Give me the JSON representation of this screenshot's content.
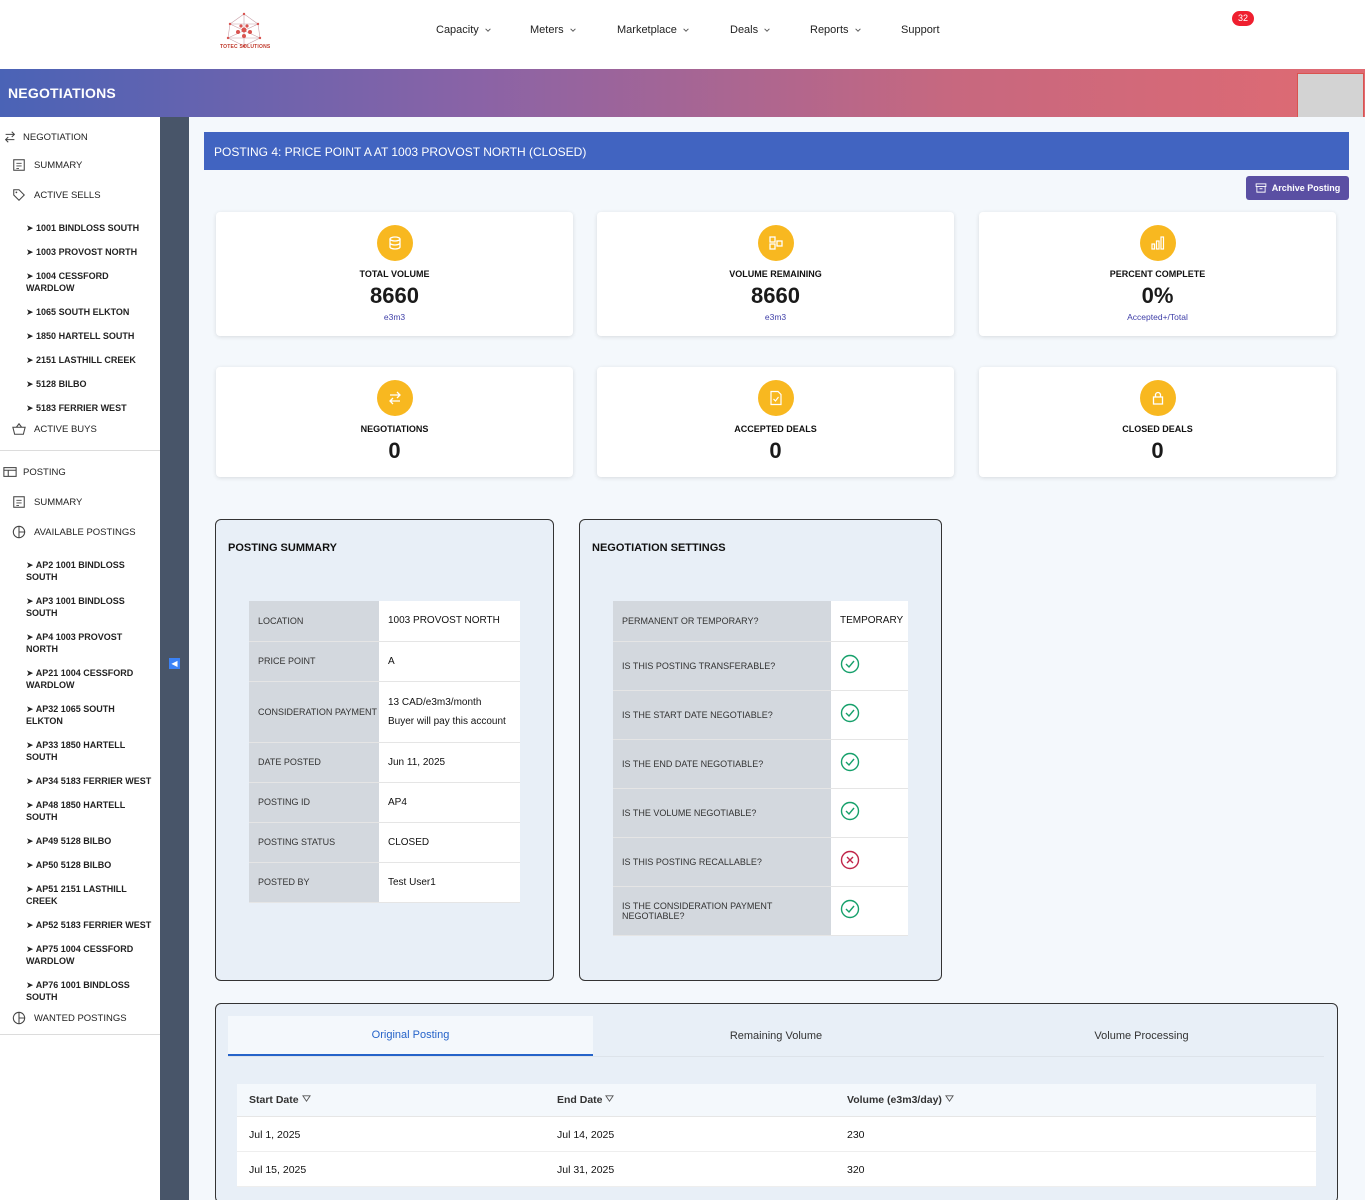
{
  "brand": {
    "logo_text": "TOTEC SOLUTIONS"
  },
  "nav": [
    {
      "label": "Capacity",
      "has_menu": true
    },
    {
      "label": "Meters",
      "has_menu": true
    },
    {
      "label": "Marketplace",
      "has_menu": true
    },
    {
      "label": "Deals",
      "has_menu": true
    },
    {
      "label": "Reports",
      "has_menu": true
    },
    {
      "label": "Support",
      "has_menu": false
    }
  ],
  "header": {
    "title": "NEGOTIATIONS",
    "notifications_count": "32"
  },
  "sidebar": {
    "negotiation_label": "NEGOTIATION",
    "negotiation_summary": "SUMMARY",
    "active_sells_label": "ACTIVE SELLS",
    "active_sells": [
      "➤ 1001 BINDLOSS SOUTH",
      "➤ 1003 PROVOST NORTH",
      "➤ 1004 CESSFORD WARDLOW",
      "➤ 1065 SOUTH ELKTON",
      "➤ 1850 HARTELL SOUTH",
      "➤ 2151 LASTHILL CREEK",
      "➤ 5128 BILBO",
      "➤ 5183 FERRIER WEST"
    ],
    "active_buys_label": "ACTIVE BUYS",
    "posting_label": "POSTING",
    "posting_summary": "SUMMARY",
    "available_postings_label": "AVAILABLE POSTINGS",
    "available_postings": [
      "➤ AP2 1001 BINDLOSS SOUTH",
      "➤ AP3 1001 BINDLOSS SOUTH",
      "➤ AP4 1003 PROVOST NORTH",
      "➤ AP21 1004 CESSFORD WARDLOW",
      "➤ AP32 1065 SOUTH ELKTON",
      "➤ AP33 1850 HARTELL SOUTH",
      "➤ AP34 5183 FERRIER WEST",
      "➤ AP48 1850 HARTELL SOUTH",
      "➤ AP49 5128 BILBO",
      "➤ AP50 5128 BILBO",
      "➤ AP51 2151 LASTHILL CREEK",
      "➤ AP52 5183 FERRIER WEST",
      "➤ AP75 1004 CESSFORD WARDLOW",
      "➤ AP76 1001 BINDLOSS SOUTH"
    ],
    "wanted_postings_label": "WANTED POSTINGS"
  },
  "posting": {
    "title": "POSTING 4: PRICE POINT A AT 1003 PROVOST NORTH (CLOSED)",
    "archive_label": "Archive Posting"
  },
  "stats": [
    {
      "label": "TOTAL VOLUME",
      "value": "8660",
      "sub": "e3m3",
      "icon": "database-icon"
    },
    {
      "label": "VOLUME REMAINING",
      "value": "8660",
      "sub": "e3m3",
      "icon": "shapes-icon"
    },
    {
      "label": "PERCENT COMPLETE",
      "value": "0%",
      "sub": "Accepted+/Total",
      "icon": "bar-chart-icon"
    },
    {
      "label": "NEGOTIATIONS",
      "value": "0",
      "sub": "",
      "icon": "swap-icon"
    },
    {
      "label": "ACCEPTED DEALS",
      "value": "0",
      "sub": "",
      "icon": "document-check-icon"
    },
    {
      "label": "CLOSED DEALS",
      "value": "0",
      "sub": "",
      "icon": "lock-icon"
    }
  ],
  "posting_summary": {
    "title": "POSTING SUMMARY",
    "rows": [
      {
        "key": "LOCATION",
        "value": "1003 PROVOST NORTH"
      },
      {
        "key": "PRICE POINT",
        "value": "A"
      },
      {
        "key": "CONSIDERATION PAYMENT",
        "value": "13 CAD/e3m3/month",
        "value2": "Buyer will pay this account"
      },
      {
        "key": "DATE POSTED",
        "value": "Jun 11, 2025"
      },
      {
        "key": "POSTING ID",
        "value": "AP4"
      },
      {
        "key": "POSTING STATUS",
        "value": "CLOSED"
      },
      {
        "key": "POSTED BY",
        "value": "Test User1"
      }
    ]
  },
  "negotiation_settings": {
    "title": "NEGOTIATION SETTINGS",
    "rows": [
      {
        "key": "PERMANENT OR TEMPORARY?",
        "value": "TEMPORARY"
      },
      {
        "key": "IS THIS POSTING TRANSFERABLE?",
        "state": "yes"
      },
      {
        "key": "IS THE START DATE NEGOTIABLE?",
        "state": "yes"
      },
      {
        "key": "IS THE END DATE NEGOTIABLE?",
        "state": "yes"
      },
      {
        "key": "IS THE VOLUME NEGOTIABLE?",
        "state": "yes"
      },
      {
        "key": "IS THIS POSTING RECALLABLE?",
        "state": "no"
      },
      {
        "key": "IS THE CONSIDERATION PAYMENT NEGOTIABLE?",
        "state": "yes"
      }
    ]
  },
  "tabs": [
    {
      "label": "Original Posting",
      "active": true
    },
    {
      "label": "Remaining Volume",
      "active": false
    },
    {
      "label": "Volume Processing",
      "active": false
    }
  ],
  "volume_table": {
    "headers": [
      "Start Date",
      "End Date",
      "Volume (e3m3/day)"
    ],
    "rows": [
      [
        "Jul 1, 2025",
        "Jul 14, 2025",
        "230"
      ],
      [
        "Jul 15, 2025",
        "Jul 31, 2025",
        "320"
      ]
    ]
  },
  "colors": {
    "accent": "#4164c1",
    "stat_icon": "#f8b820",
    "check_yes": "#16a06b",
    "check_no": "#c0264a",
    "archive": "#5a4fa3"
  }
}
